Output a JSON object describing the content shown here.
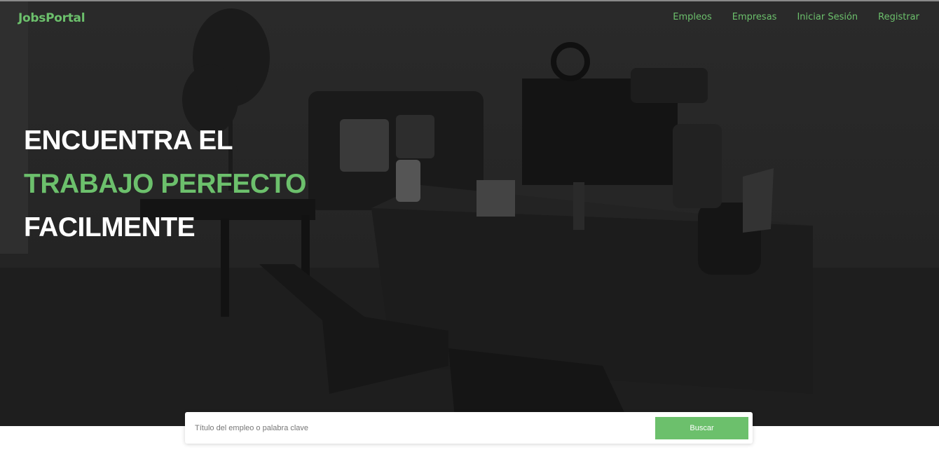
{
  "brand": {
    "name": "JobsPortal"
  },
  "nav": {
    "items": [
      {
        "label": "Empleos"
      },
      {
        "label": "Empresas"
      },
      {
        "label": "Iniciar Sesión"
      },
      {
        "label": "Registrar"
      }
    ]
  },
  "hero": {
    "line1": "ENCUENTRA EL",
    "line2": "TRABAJO PERFECTO",
    "line3": "FACILMENTE",
    "background": "office-photo"
  },
  "search": {
    "placeholder": "Título del empleo o palabra clave",
    "value": "",
    "button_label": "Buscar"
  },
  "colors": {
    "accent": "#6cc06c",
    "overlay": "#262626",
    "headline": "#ffffff"
  }
}
